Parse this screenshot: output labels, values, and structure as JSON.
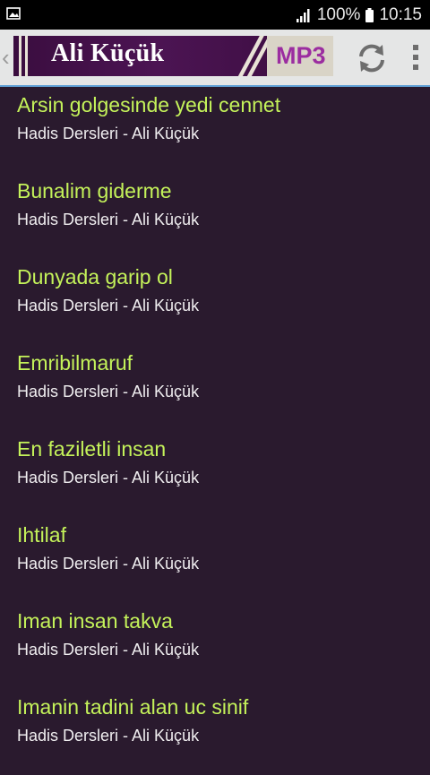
{
  "status_bar": {
    "battery": "100%",
    "time": "10:15",
    "icons": [
      "image-icon",
      "signal-icon",
      "battery-icon"
    ]
  },
  "action_bar": {
    "logo": {
      "title": "Ali Küçük",
      "badge": "MP3"
    },
    "icons": [
      "up-chevron-icon",
      "refresh-icon",
      "overflow-menu-icon"
    ],
    "colors": {
      "background": "#e5e6e6",
      "accent": "#5fa0d6",
      "logo_bg": "#3a0d3f",
      "mp3_text": "#9b2da0"
    }
  },
  "tracks": [
    {
      "title": "Arsin golgesinde yedi cennet",
      "subtitle": "Hadis Dersleri - Ali Küçük"
    },
    {
      "title": "Bunalim giderme",
      "subtitle": "Hadis Dersleri - Ali Küçük"
    },
    {
      "title": "Dunyada garip ol",
      "subtitle": "Hadis Dersleri - Ali Küçük"
    },
    {
      "title": "Emribilmaruf",
      "subtitle": "Hadis Dersleri - Ali Küçük"
    },
    {
      "title": "En faziletli insan",
      "subtitle": "Hadis Dersleri - Ali Küçük"
    },
    {
      "title": "Ihtilaf",
      "subtitle": "Hadis Dersleri - Ali Küçük"
    },
    {
      "title": "Iman insan takva",
      "subtitle": "Hadis Dersleri - Ali Küçük"
    },
    {
      "title": "Imanin tadini alan uc sinif",
      "subtitle": "Hadis Dersleri - Ali Küçük"
    }
  ],
  "colors": {
    "list_bg": "#2a1a2e",
    "title": "#c4f25a",
    "subtitle": "#f0eef0"
  }
}
